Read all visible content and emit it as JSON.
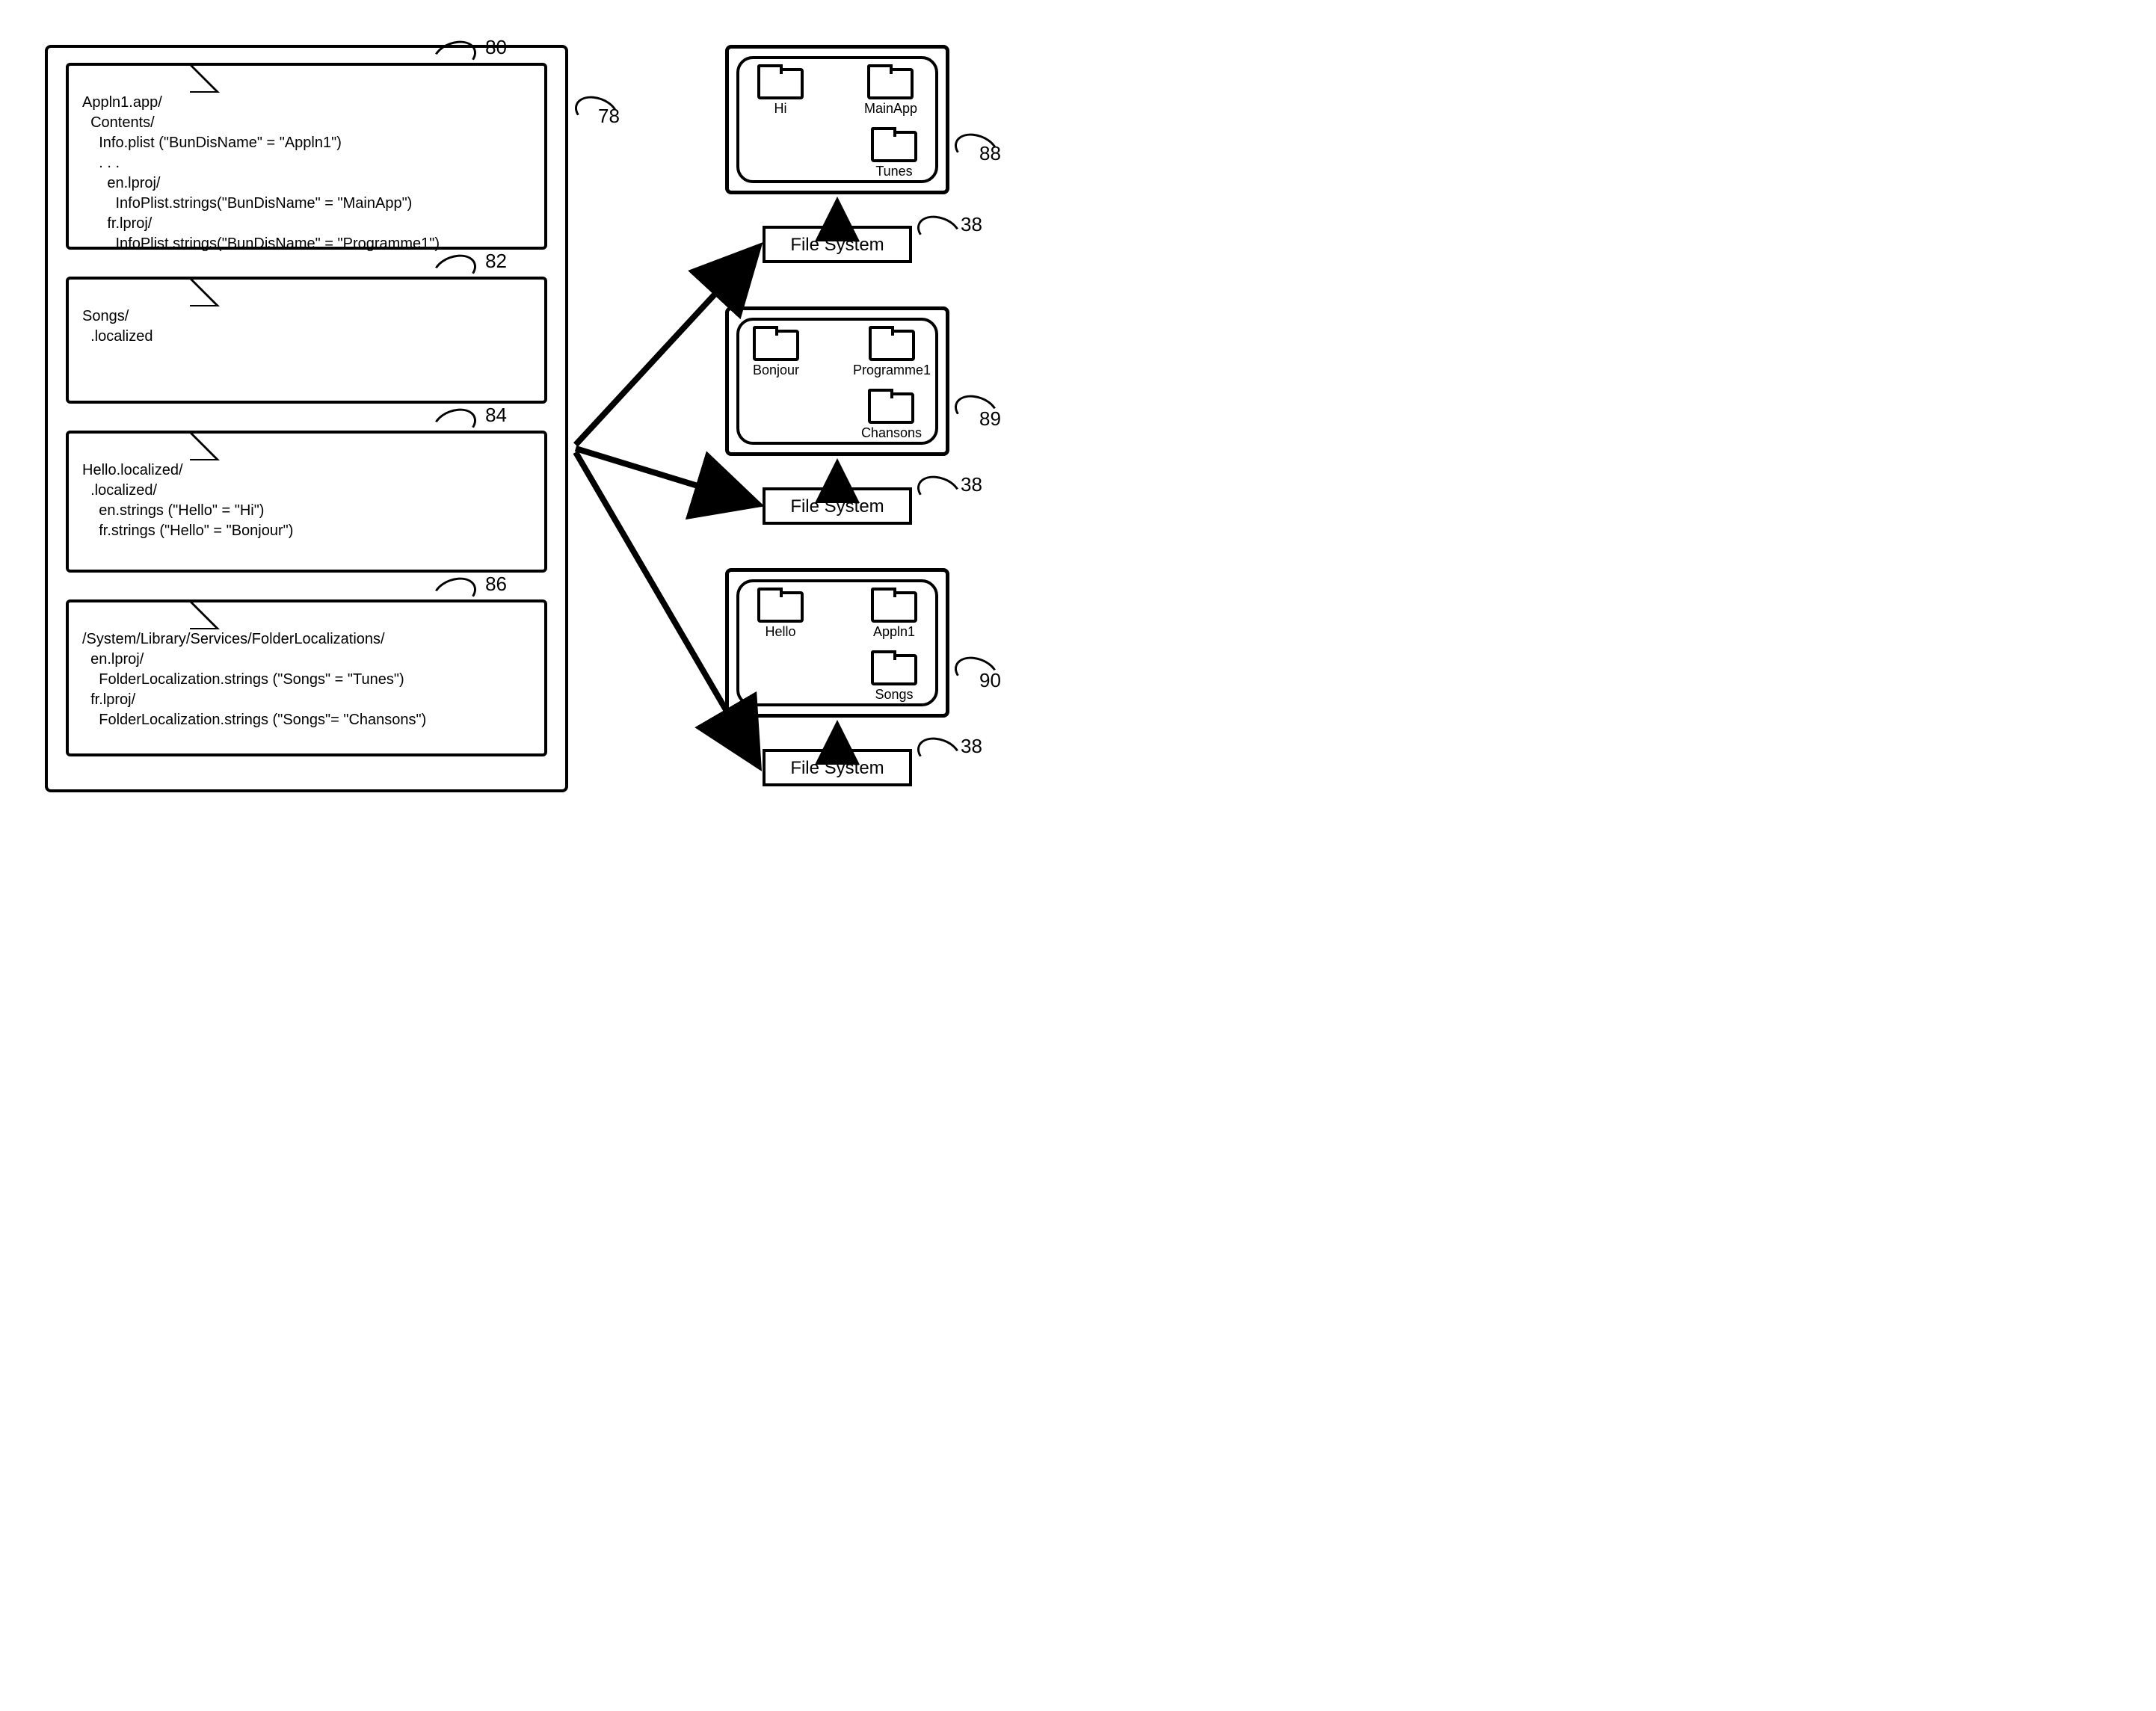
{
  "refs": {
    "main": "78",
    "f80": "80",
    "f82": "82",
    "f84": "84",
    "f86": "86",
    "w88": "88",
    "w89": "89",
    "w90": "90",
    "fs": "38"
  },
  "fs_label": "File System",
  "folder80": {
    "lines": [
      "Appln1.app/",
      "  Contents/",
      "    Info.plist (\"BunDisName\" = \"Appln1\")",
      "    . . .",
      "      en.lproj/",
      "        InfoPlist.strings(\"BunDisName\" = \"MainApp\")",
      "      fr.lproj/",
      "        InfoPlist.strings(\"BunDisName\" = \"Programme1\")"
    ]
  },
  "folder82": {
    "lines": [
      "Songs/",
      "  .localized"
    ]
  },
  "folder84": {
    "lines": [
      "Hello.localized/",
      "  .localized/",
      "    en.strings (\"Hello\" = \"Hi\")",
      "    fr.strings (\"Hello\" = \"Bonjour\")"
    ]
  },
  "folder86": {
    "lines": [
      "/System/Library/Services/FolderLocalizations/",
      "  en.lproj/",
      "    FolderLocalization.strings (\"Songs\" = \"Tunes\")",
      "  fr.lproj/",
      "    FolderLocalization.strings (\"Songs\"= \"Chansons\")"
    ]
  },
  "window88": {
    "items": [
      "Hi",
      "MainApp",
      "Tunes"
    ]
  },
  "window89": {
    "items": [
      "Bonjour",
      "Programme1",
      "Chansons"
    ]
  },
  "window90": {
    "items": [
      "Hello",
      "Appln1",
      "Songs"
    ]
  }
}
